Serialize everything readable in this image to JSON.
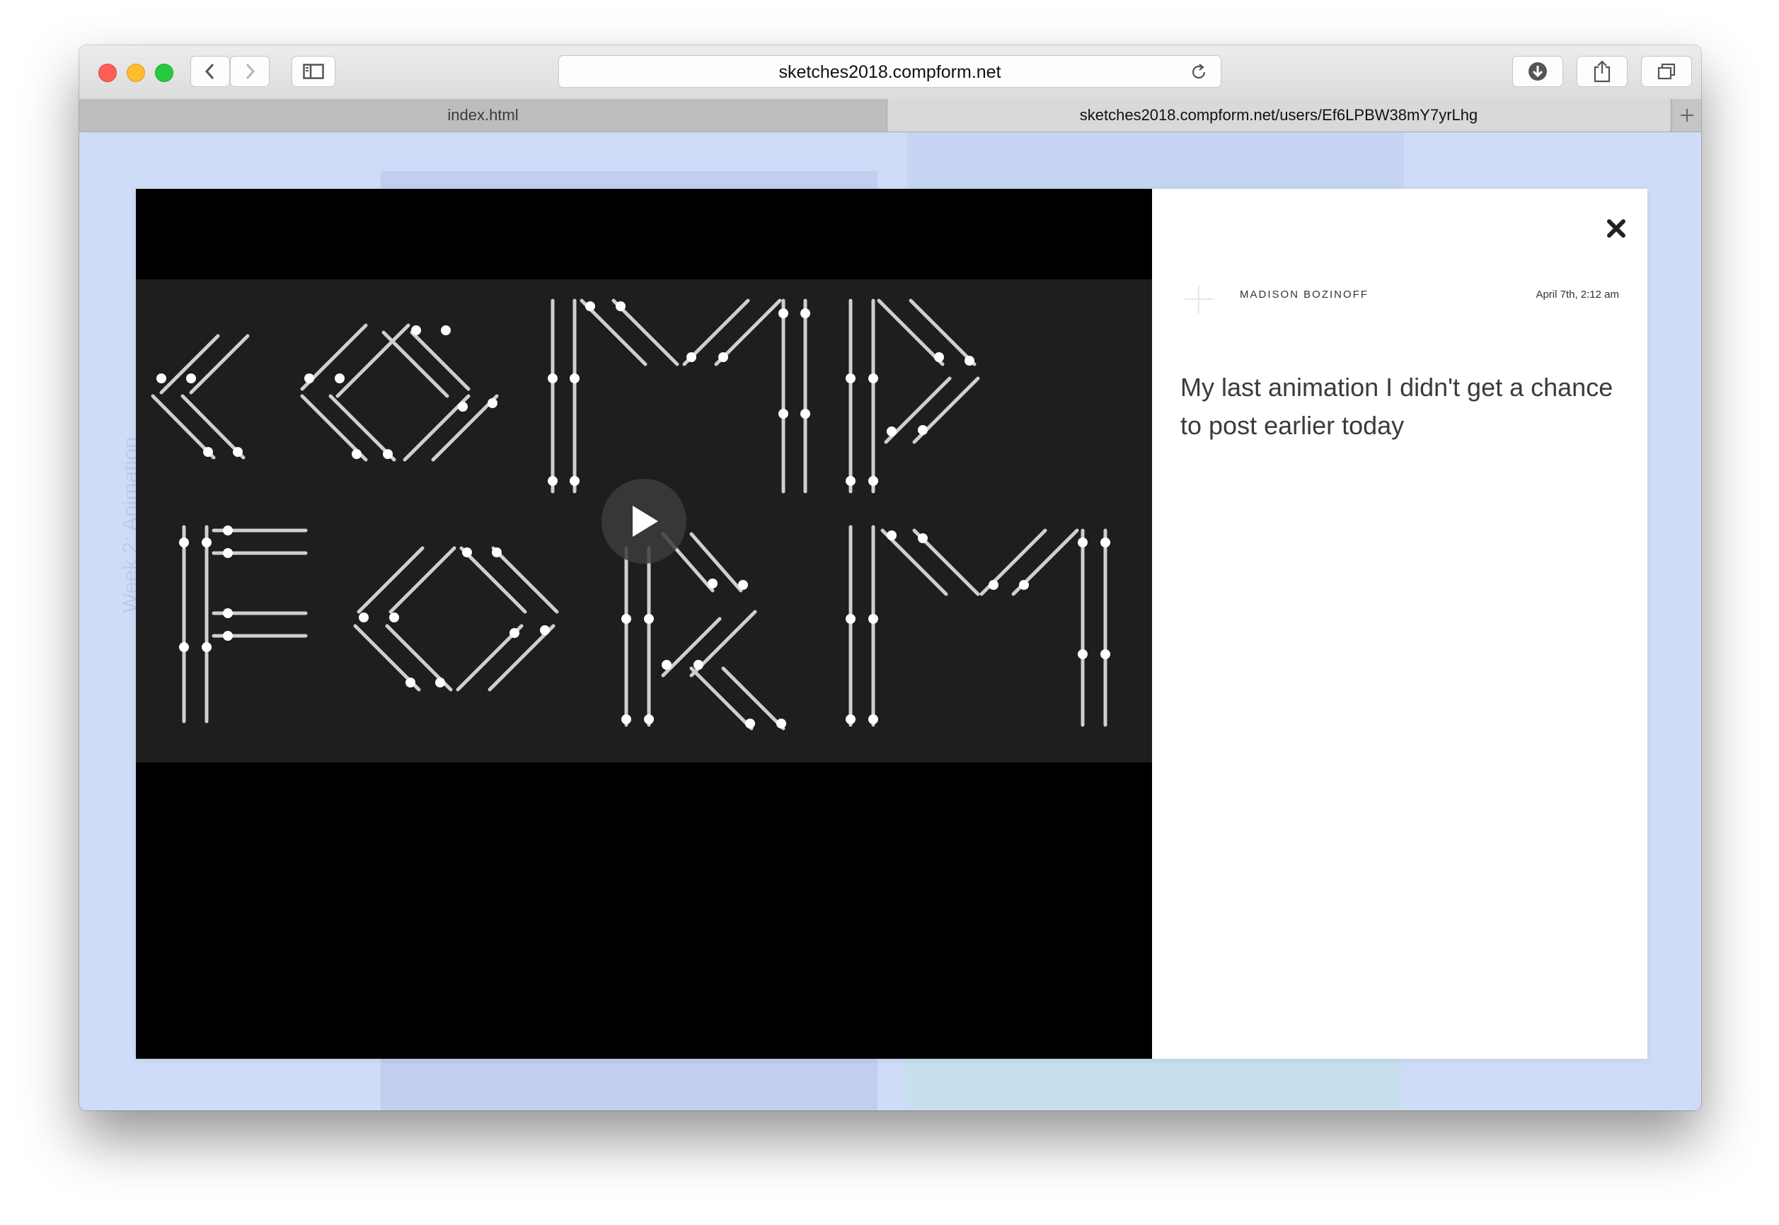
{
  "browser": {
    "address": "sketches2018.compform.net",
    "tabs": [
      {
        "label": "index.html"
      },
      {
        "label": "sketches2018.compform.net/users/Ef6LPBW38mY7yrLhg"
      }
    ]
  },
  "background": {
    "vertical_label": "Week 2: Animation"
  },
  "post": {
    "author": "MADISON BOZINOFF",
    "date": "April 7th, 2:12 am",
    "text": "My last animation I didn't get a chance to post earlier today"
  }
}
